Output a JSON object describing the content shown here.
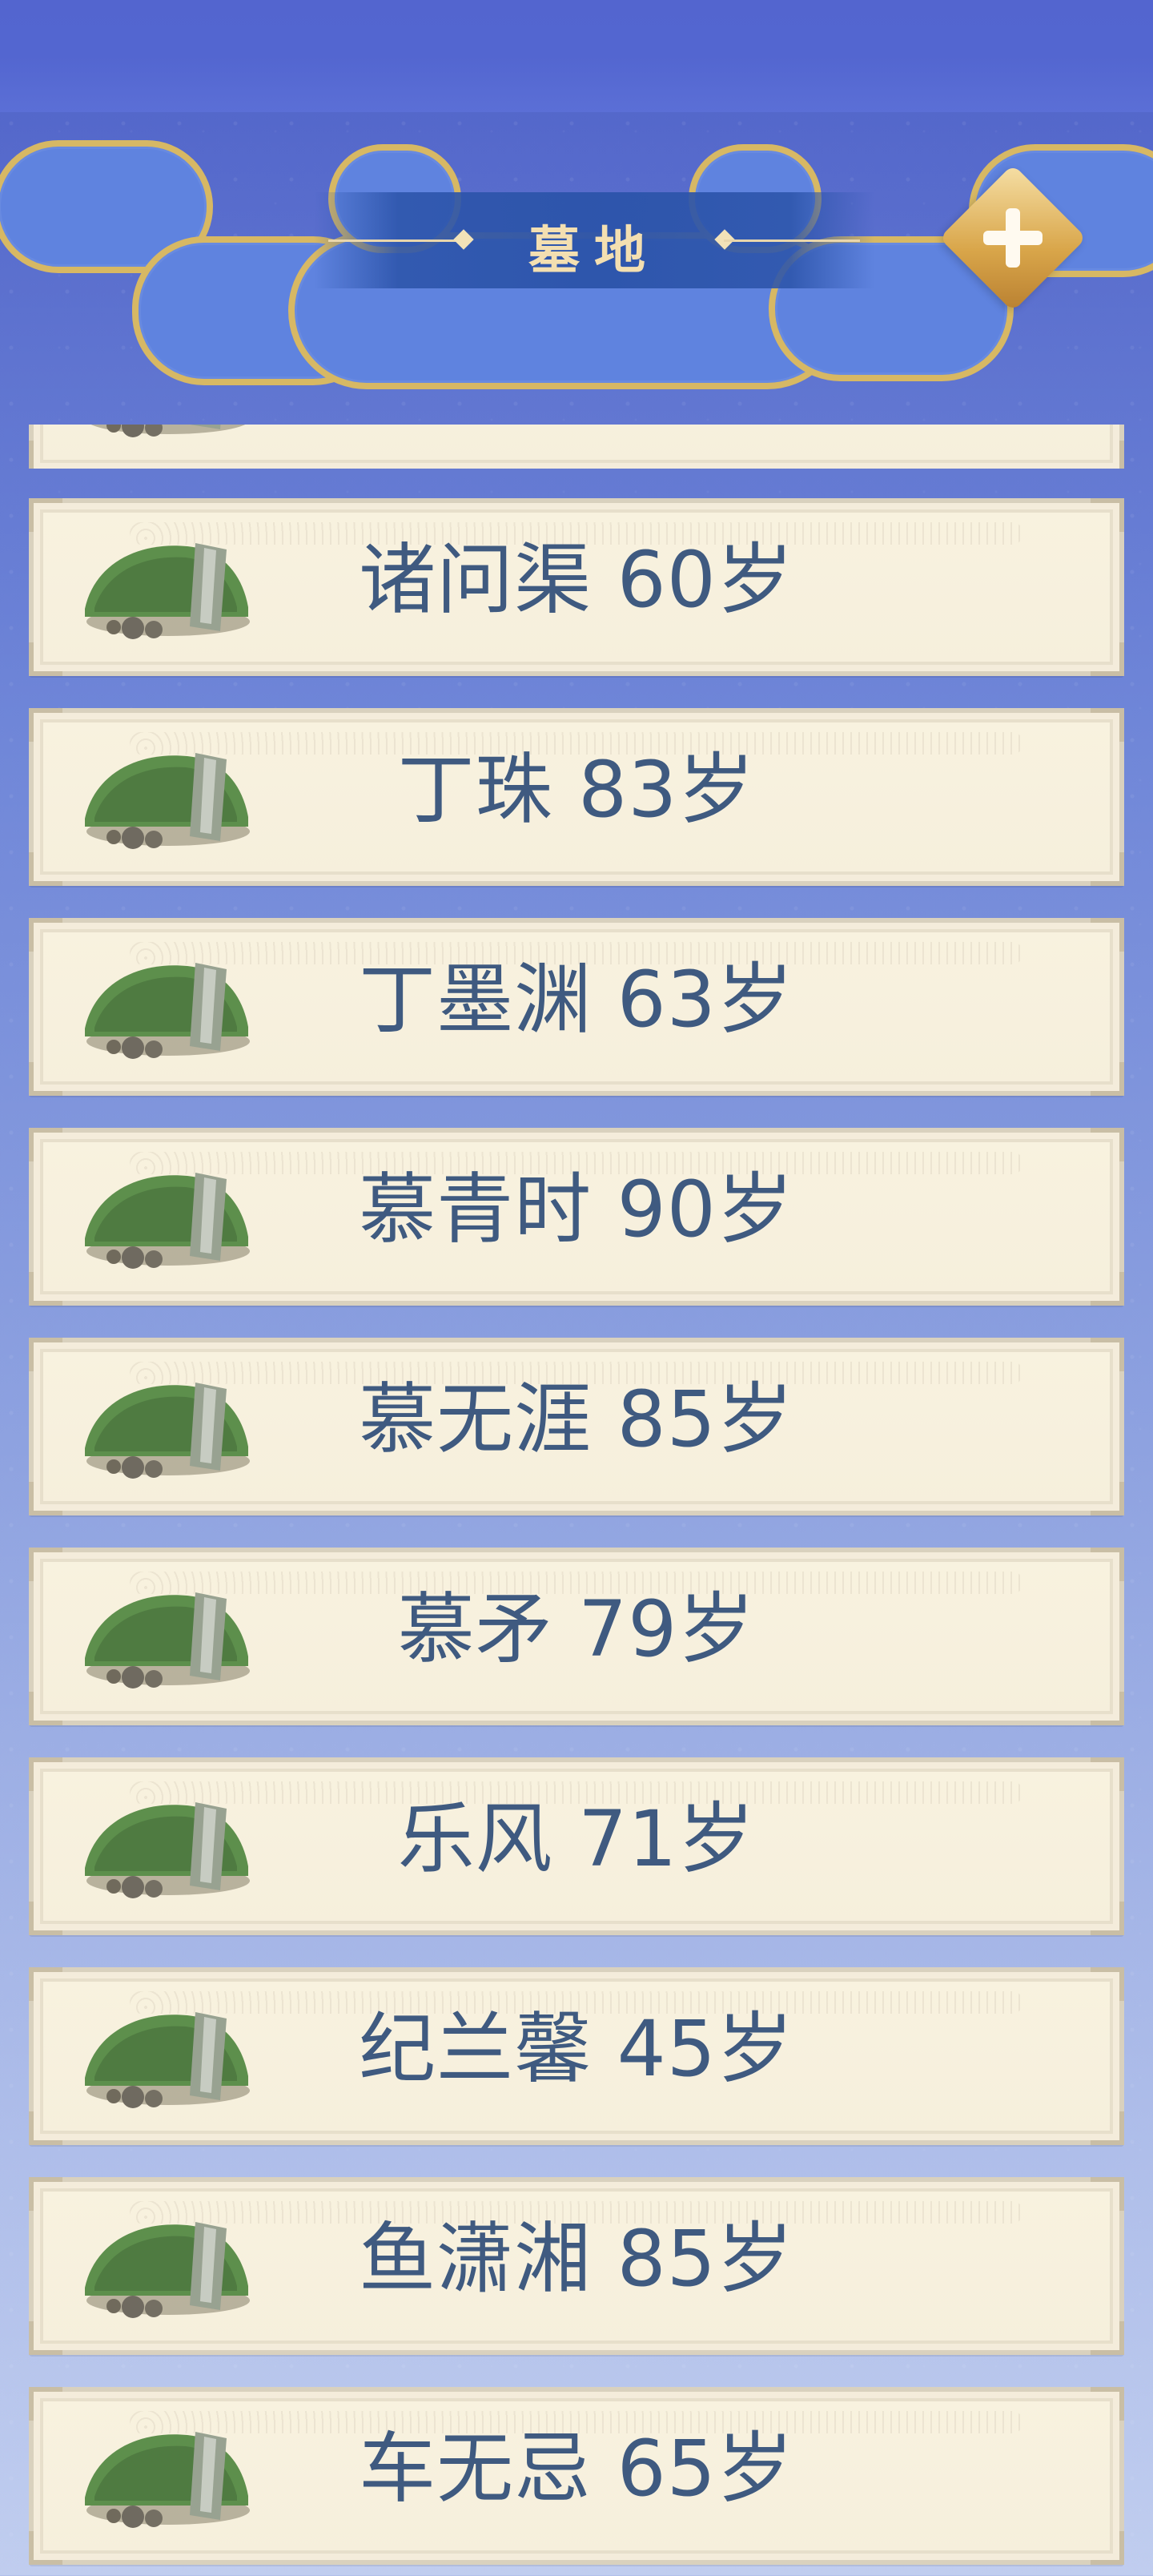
{
  "header": {
    "title": "墓地",
    "close_label": ""
  },
  "items": [
    {
      "label": "诸问渠 60岁"
    },
    {
      "label": "丁珠 83岁"
    },
    {
      "label": "丁墨渊 63岁"
    },
    {
      "label": "慕青时 90岁"
    },
    {
      "label": "慕无涯 85岁"
    },
    {
      "label": "慕矛 79岁"
    },
    {
      "label": "乐风 71岁"
    },
    {
      "label": "纪兰馨 45岁"
    },
    {
      "label": "鱼潇湘 85岁"
    },
    {
      "label": "车无忌 65岁"
    }
  ],
  "colors": {
    "accent": "#d9a64a",
    "title": "#f3dfb1",
    "text": "#3f5a80"
  }
}
